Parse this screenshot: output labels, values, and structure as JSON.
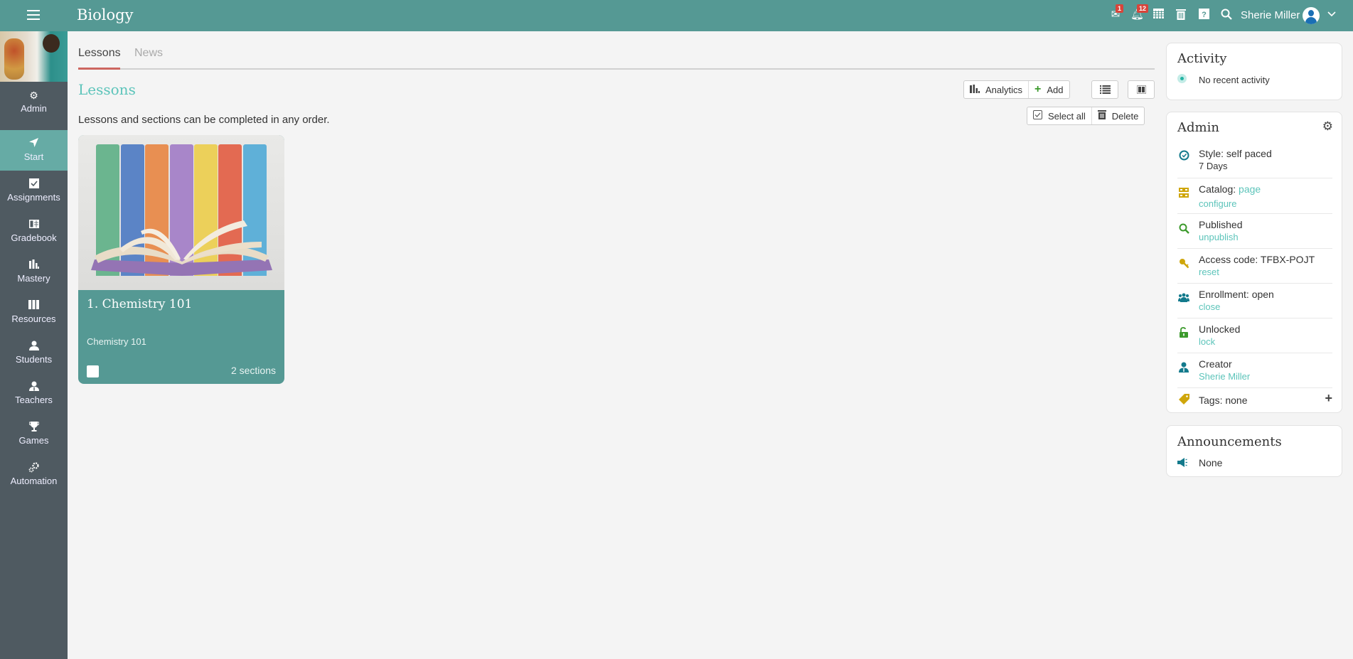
{
  "header": {
    "title": "Biology",
    "messages_badge": "1",
    "notifications_badge": "12",
    "user_name": "Sherie Miller"
  },
  "sidebar": {
    "items": [
      {
        "label": "Admin",
        "icon": "gear-icon"
      },
      {
        "label": "Start",
        "icon": "navigation-arrow-icon",
        "active": true
      },
      {
        "label": "Assignments",
        "icon": "assignment-check-icon"
      },
      {
        "label": "Gradebook",
        "icon": "gradebook-icon"
      },
      {
        "label": "Mastery",
        "icon": "bar-chart-icon"
      },
      {
        "label": "Resources",
        "icon": "books-icon"
      },
      {
        "label": "Students",
        "icon": "student-icon"
      },
      {
        "label": "Teachers",
        "icon": "teacher-icon"
      },
      {
        "label": "Games",
        "icon": "trophy-icon"
      },
      {
        "label": "Automation",
        "icon": "gears-icon"
      }
    ]
  },
  "tabs": [
    {
      "label": "Lessons",
      "active": true
    },
    {
      "label": "News",
      "active": false
    }
  ],
  "main": {
    "heading": "Lessons",
    "description": "Lessons and sections can be completed in any order.",
    "toolbar": {
      "analytics": "Analytics",
      "add": "Add",
      "select_all": "Select all",
      "delete": "Delete"
    },
    "lessons": [
      {
        "title": "1. Chemistry 101",
        "subtitle": "Chemistry 101",
        "sections": "2 sections"
      }
    ]
  },
  "activity": {
    "title": "Activity",
    "text": "No recent activity"
  },
  "admin": {
    "title": "Admin",
    "rows": [
      {
        "line1": "Style: self paced",
        "line2": "7 Days"
      },
      {
        "line1_prefix": "Catalog: ",
        "line1_link": "page",
        "line2": "configure"
      },
      {
        "line1": "Published",
        "line2": "unpublish"
      },
      {
        "line1": "Access code: TFBX-POJT",
        "line2": "reset"
      },
      {
        "line1": "Enrollment: open",
        "line2": "close"
      },
      {
        "line1": "Unlocked",
        "line2": "lock"
      },
      {
        "line1": "Creator",
        "line2": "Sherie Miller"
      },
      {
        "line1": "Tags: none"
      }
    ]
  },
  "announcements": {
    "title": "Announcements",
    "text": "None"
  },
  "colors": {
    "brand": "#559994",
    "accent_link": "#5cc4ba",
    "sidebar": "#4f5a61",
    "tab_underline": "#cd6660",
    "badge": "#d9443a"
  }
}
